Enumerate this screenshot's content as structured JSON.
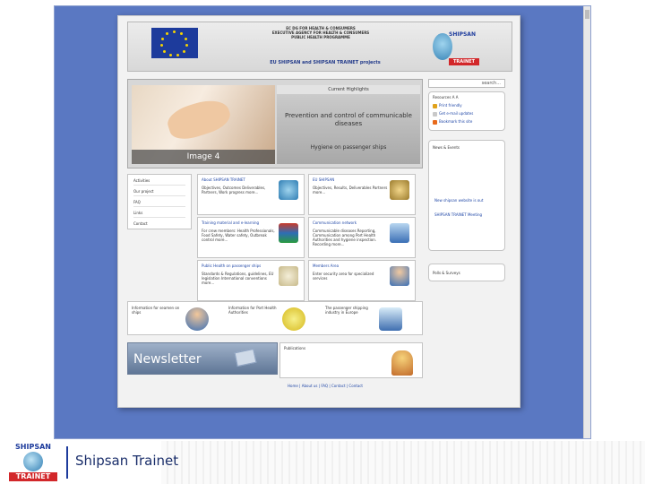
{
  "banner": {
    "lines": [
      "EC DG FOR HEALTH & CONSUMERS",
      "EXECUTIVE AGENCY FOR HEALTH & CONSUMERS",
      "PUBLIC HEALTH PROGRAMME"
    ],
    "project_title": "EU SHIPSAN and SHIPSAN TRAINET projects",
    "logo_top": "SHIPSAN",
    "logo_bottom": "TRAINET"
  },
  "hero": {
    "image_caption": "Image 4",
    "tab_label": "Current Highlights",
    "headline": "Prevention and control of communicable diseases",
    "subline": "Hygiene on passenger ships"
  },
  "search": {
    "label": "search..."
  },
  "quick_links": {
    "header": "Resources  A  A",
    "items": [
      "Print friendly",
      "Get e-mail updates",
      "Bookmark this site"
    ]
  },
  "news": {
    "header": "News & Events",
    "items": [
      "New shipsan website is out",
      "SHIPSAN TRAINET Meeting"
    ]
  },
  "polls": {
    "header": "Polls & Surveys"
  },
  "left_nav": {
    "items": [
      "Activities",
      "Our project",
      "FAQ",
      "Links",
      "Contact"
    ]
  },
  "cells": [
    {
      "title": "About SHIPSAN TRAINET",
      "body": "Objectives, Outcomes Deliverables, Partners, Work progress more..."
    },
    {
      "title": "EU SHIPSAN",
      "body": "Objectives, Results, Deliverables Partners more..."
    },
    {
      "title": "Training material and e-learning",
      "body": "For crew members: Health Professionals, Food Safety, Water safety, Outbreak control more..."
    },
    {
      "title": "Communication network",
      "body": "Communicable diseases Reporting, Communication among Port Health Authorities and hygiene inspection. Recording more..."
    },
    {
      "title": "Public Health on passenger ships",
      "body": "Standards & Regulations, guidelines, EU legislation International conventions more..."
    },
    {
      "title": "Members Area",
      "body": "Enter security area for specialized services"
    }
  ],
  "info_row": [
    {
      "title": "Information for seamen on ships"
    },
    {
      "title": "Information for Port Health Authorities"
    },
    {
      "title": "The passenger shipping industry in Europe"
    }
  ],
  "newsletter": {
    "label": "Newsletter"
  },
  "publications": {
    "label": "Publications"
  },
  "footer": {
    "links": "Home | About us | FAQ | Contact | Contact"
  },
  "slide": {
    "logo_top": "SHIPSAN",
    "logo_bottom": "TRAINET",
    "title": "Shipsan Trainet"
  },
  "colors": {
    "screenshot_bg": "#5a78c2",
    "brand_blue": "#1d3b9c",
    "brand_red": "#d2272a",
    "link_blue": "#1f46a6"
  }
}
